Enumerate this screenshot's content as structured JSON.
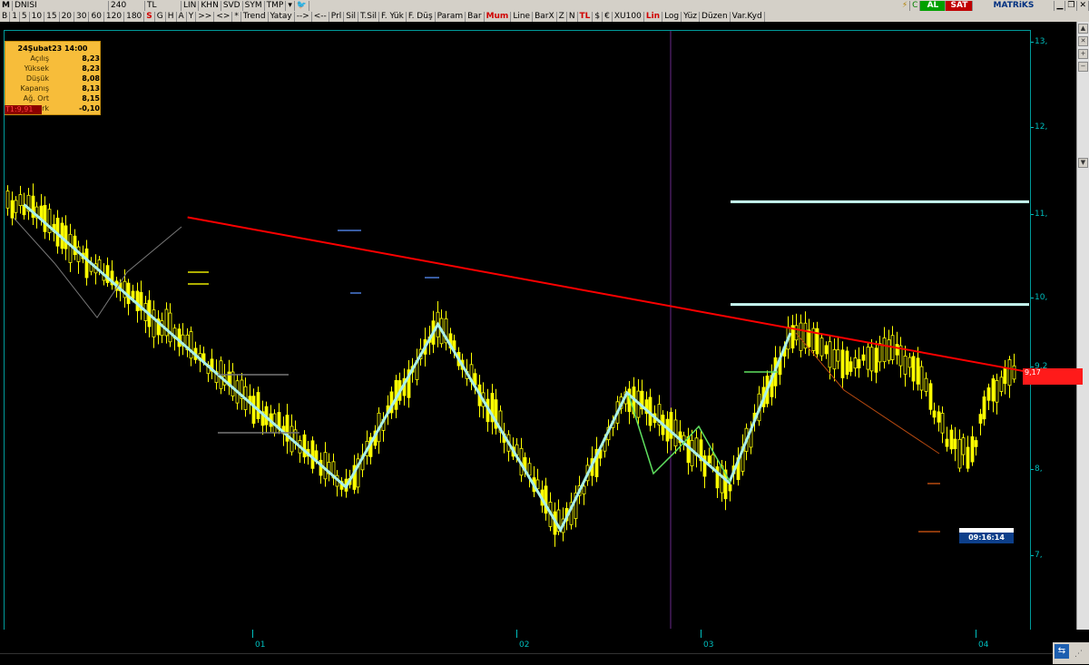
{
  "toolbar_top": {
    "symbol": "DNISI",
    "period": "240",
    "currency": "TL",
    "items": [
      "LIN",
      "KHN",
      "SVD",
      "SYM",
      "TMP"
    ],
    "right_items": [
      "AL",
      "SAT",
      "MATRiKS"
    ]
  },
  "toolbar_bottom": {
    "items": [
      "B",
      "1",
      "5",
      "10",
      "15",
      "20",
      "30",
      "60",
      "120",
      "180",
      "S",
      "G",
      "H",
      "A",
      "Y",
      ">>",
      "<>",
      "*",
      "Trend",
      "Yatay",
      "-->",
      "<--",
      "Prl",
      "Sil",
      "T.Sil",
      "F. Yük",
      "F. Düş",
      "Param",
      "Bar",
      "Mum",
      "Line",
      "BarX",
      "Z",
      "N",
      "TL",
      "$",
      "€",
      "XU100",
      "Lin",
      "Log",
      "Yüz",
      "Düzen",
      "Var.Kyd"
    ],
    "highlight": [
      "S",
      "Mum",
      "TL",
      "Lin"
    ]
  },
  "infobox": {
    "title": "24Şubat23 14:00",
    "rows": [
      {
        "label": "Açılış",
        "value": "8,23"
      },
      {
        "label": "Yüksek",
        "value": "8,23"
      },
      {
        "label": "Düşük",
        "value": "8,08"
      },
      {
        "label": "Kapanış",
        "value": "8,13"
      },
      {
        "label": "Ağ. Ort",
        "value": "8,15"
      },
      {
        "label": "Fark",
        "value": "-0,10"
      }
    ],
    "t1_label": "T1:9,91"
  },
  "y_axis": {
    "labels": [
      "13,",
      "12,",
      "11,",
      "10,",
      "9,2",
      "8,",
      "7,"
    ]
  },
  "price_badge": "9,17",
  "x_axis": {
    "labels": [
      "01",
      "02",
      "03",
      "04"
    ]
  },
  "time_flag": "09:16:14",
  "colors": {
    "candle": "#ffff00",
    "zigzag": "#aaf0e8",
    "trendline": "#ff0000",
    "axis": "#00bdbd",
    "badge": "#ff1a1a"
  },
  "chart_data": {
    "type": "line",
    "ylim": [
      6.3,
      13.2
    ],
    "resistance_levels": [
      11.1,
      9.9
    ],
    "trendline": [
      [
        0.18,
        10.95
      ],
      [
        1.0,
        9.15
      ]
    ],
    "zigzag": [
      [
        0.02,
        11.1
      ],
      [
        0.335,
        7.8
      ],
      [
        0.425,
        9.7
      ],
      [
        0.545,
        7.3
      ],
      [
        0.61,
        8.9
      ],
      [
        0.71,
        7.85
      ],
      [
        0.77,
        9.6
      ]
    ],
    "current_price": 9.17
  }
}
